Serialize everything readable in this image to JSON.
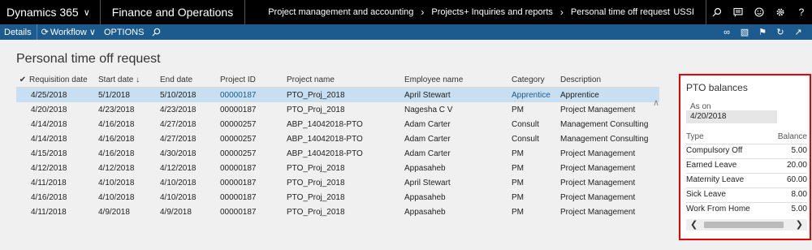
{
  "topbar": {
    "brand": "Dynamics 365",
    "module": "Finance and Operations",
    "breadcrumbs": [
      "Project management and accounting",
      "Projects+ Inquiries and reports",
      "Personal time off request"
    ],
    "company": "USSI",
    "icons": [
      "search-icon",
      "message-icon",
      "smiley-icon",
      "gear-icon",
      "help-icon"
    ]
  },
  "actionbar": {
    "details": "Details",
    "workflow": "Workflow",
    "options": "OPTIONS",
    "right_icons": [
      "connect-icon",
      "office-icon",
      "notifications-icon",
      "refresh-icon",
      "open-new-window-icon"
    ]
  },
  "page": {
    "title": "Personal time off request"
  },
  "grid": {
    "columns": [
      "Requisition date",
      "Start date",
      "End date",
      "Project ID",
      "Project name",
      "Employee name",
      "Category",
      "Description"
    ],
    "sort_indicator": "↓",
    "rows": [
      {
        "req": "4/25/2018",
        "start": "5/1/2018",
        "end": "5/10/2018",
        "proj": "00000187",
        "pname": "PTO_Proj_2018",
        "emp": "April Stewart",
        "cat": "Apprentice",
        "desc": "Apprentice"
      },
      {
        "req": "4/20/2018",
        "start": "4/23/2018",
        "end": "4/23/2018",
        "proj": "00000187",
        "pname": "PTO_Proj_2018",
        "emp": "Nagesha C V",
        "cat": "PM",
        "desc": "Project Management"
      },
      {
        "req": "4/14/2018",
        "start": "4/16/2018",
        "end": "4/27/2018",
        "proj": "00000257",
        "pname": "ABP_14042018-PTO",
        "emp": "Adam Carter",
        "cat": "Consult",
        "desc": "Management Consulting"
      },
      {
        "req": "4/14/2018",
        "start": "4/16/2018",
        "end": "4/27/2018",
        "proj": "00000257",
        "pname": "ABP_14042018-PTO",
        "emp": "Adam Carter",
        "cat": "Consult",
        "desc": "Management Consulting"
      },
      {
        "req": "4/15/2018",
        "start": "4/16/2018",
        "end": "4/30/2018",
        "proj": "00000257",
        "pname": "ABP_14042018-PTO",
        "emp": "Adam Carter",
        "cat": "PM",
        "desc": "Project Management"
      },
      {
        "req": "4/12/2018",
        "start": "4/12/2018",
        "end": "4/12/2018",
        "proj": "00000187",
        "pname": "PTO_Proj_2018",
        "emp": "Appasaheb",
        "cat": "PM",
        "desc": "Project Management"
      },
      {
        "req": "4/11/2018",
        "start": "4/10/2018",
        "end": "4/10/2018",
        "proj": "00000187",
        "pname": "PTO_Proj_2018",
        "emp": "April Stewart",
        "cat": "PM",
        "desc": "Project Management"
      },
      {
        "req": "4/16/2018",
        "start": "4/10/2018",
        "end": "4/10/2018",
        "proj": "00000187",
        "pname": "PTO_Proj_2018",
        "emp": "Appasaheb",
        "cat": "PM",
        "desc": "Project Management"
      },
      {
        "req": "4/11/2018",
        "start": "4/9/2018",
        "end": "4/9/2018",
        "proj": "00000187",
        "pname": "PTO_Proj_2018",
        "emp": "Appasaheb",
        "cat": "PM",
        "desc": "Project Management"
      }
    ]
  },
  "pto": {
    "title": "PTO balances",
    "as_on_label": "As on",
    "as_on_value": "4/20/2018",
    "col_type": "Type",
    "col_balance": "Balance",
    "rows": [
      {
        "type": "Compulsory Off",
        "balance": "5.00"
      },
      {
        "type": "Earned Leave",
        "balance": "20.00"
      },
      {
        "type": "Maternity Leave",
        "balance": "60.00"
      },
      {
        "type": "Sick Leave",
        "balance": "8.00"
      },
      {
        "type": "Work From Home",
        "balance": "5.00"
      }
    ]
  },
  "colors": {
    "topbar": "#000000",
    "actionbar": "#1d5b8f",
    "selected_row": "#c7dff0",
    "highlight_border": "#e00000",
    "link": "#1d5b8f"
  }
}
